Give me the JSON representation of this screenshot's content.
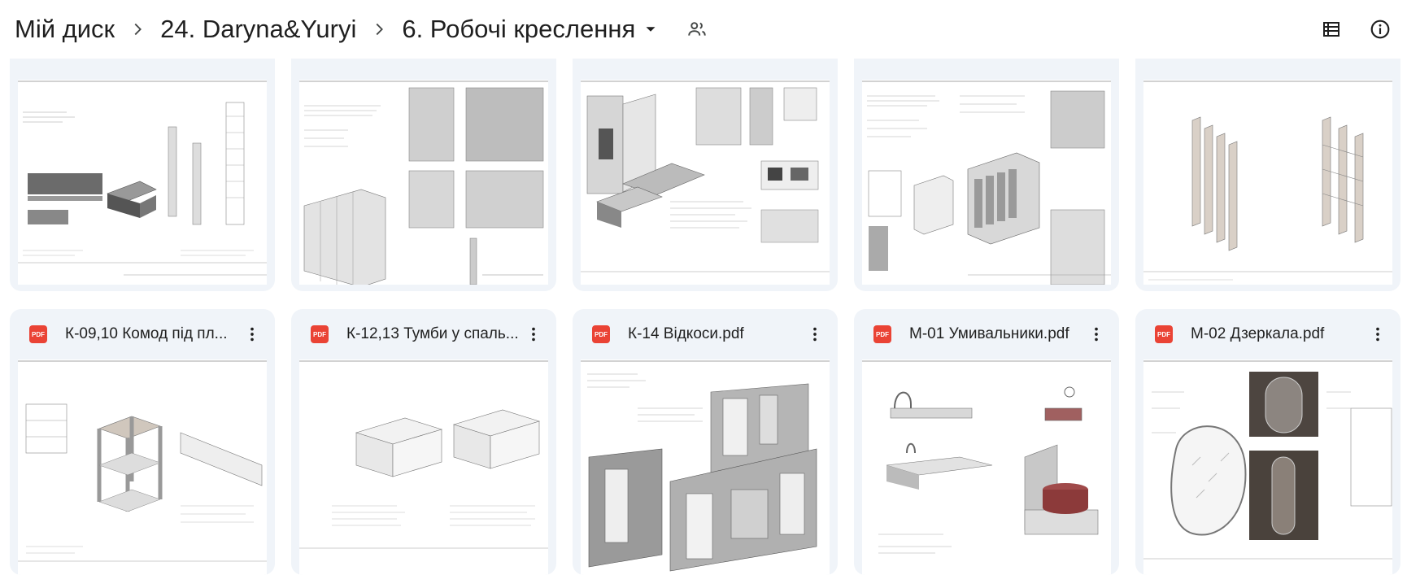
{
  "breadcrumb": {
    "items": [
      "Мій диск",
      "24. Daryna&Yuryi",
      "6. Робочі креслення"
    ]
  },
  "icons": {
    "separator": "chevron-right-icon",
    "caret": "caret-down-icon",
    "share": "shared-folder-people-icon",
    "list_view": "list-view-icon",
    "details": "info-icon",
    "file_type": "pdf-icon",
    "more": "more-vert-icon"
  },
  "colors": {
    "card_bg": "#f0f4f9",
    "pdf_red": "#ea4335",
    "text": "#1f1f1f"
  },
  "files": {
    "badge_text": "PDF",
    "row2": [
      {
        "name": "К-09,10 Комод під пл..."
      },
      {
        "name": "К-12,13 Тумби у спаль..."
      },
      {
        "name": "К-14 Відкоси.pdf"
      },
      {
        "name": "М-01 Умивальники.pdf"
      },
      {
        "name": "М-02 Дзеркала.pdf"
      }
    ]
  }
}
